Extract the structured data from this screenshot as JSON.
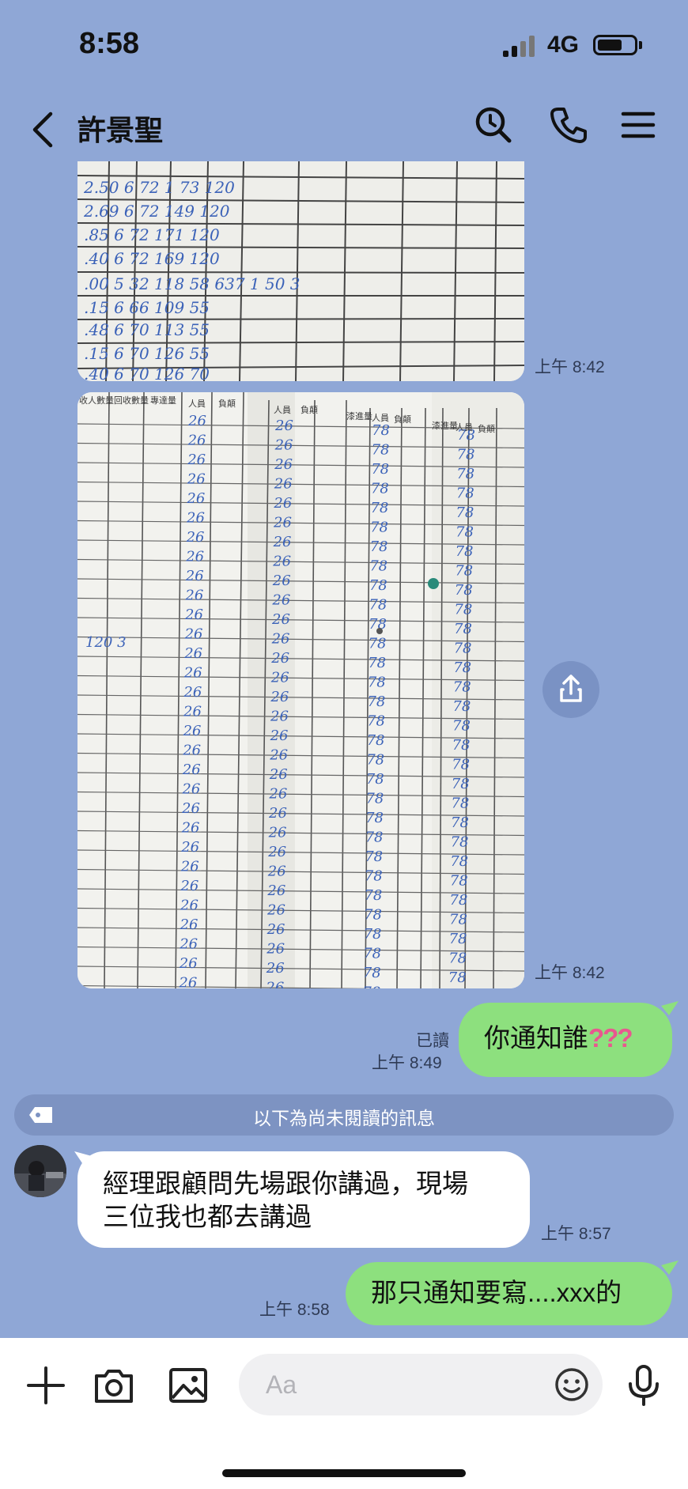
{
  "status_bar": {
    "time": "8:58",
    "network": "4G"
  },
  "header": {
    "title": "許景聖",
    "icons": [
      "back-icon",
      "search-icon",
      "phone-icon",
      "menu-icon"
    ]
  },
  "messages": [
    {
      "type": "image",
      "direction": "incoming",
      "timestamp": "上午 8:42"
    },
    {
      "type": "image",
      "direction": "incoming",
      "timestamp": "上午 8:42"
    },
    {
      "type": "text",
      "direction": "outgoing",
      "text": "你通知誰",
      "emoji": "???",
      "read": "已讀",
      "timestamp": "上午 8:49"
    },
    {
      "type": "text",
      "direction": "incoming",
      "lines": [
        "經理跟顧問先場跟你講過，現場",
        "三位我也都去講過"
      ],
      "timestamp": "上午 8:57"
    },
    {
      "type": "text",
      "direction": "outgoing",
      "text": "那只通知要寫....xxx的",
      "timestamp": "上午 8:58"
    }
  ],
  "unread_divider": "以下為尚未閱讀的訊息",
  "input_bar": {
    "placeholder": "Aa",
    "icons": [
      "plus-icon",
      "camera-icon",
      "image-icon",
      "emoji-icon",
      "microphone-icon"
    ]
  },
  "colors": {
    "chat_background": "#8fa7d6",
    "outgoing_bubble": "#8de07e",
    "incoming_bubble": "#ffffff",
    "handwriting_ink": "#3b62b8"
  }
}
